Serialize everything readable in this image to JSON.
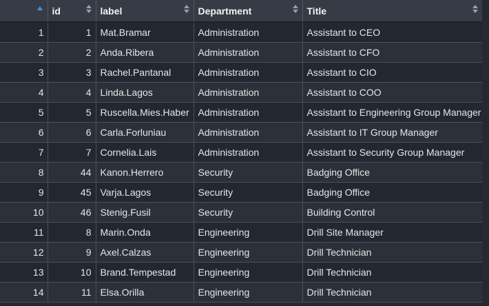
{
  "table": {
    "columns": [
      {
        "key": "rownum",
        "label": ""
      },
      {
        "key": "id",
        "label": "id"
      },
      {
        "key": "label",
        "label": "label"
      },
      {
        "key": "department",
        "label": "Department"
      },
      {
        "key": "title",
        "label": "Title"
      }
    ],
    "rows": [
      {
        "rownum": "1",
        "id": "1",
        "label": "Mat.Bramar",
        "department": "Administration",
        "title": "Assistant to CEO"
      },
      {
        "rownum": "2",
        "id": "2",
        "label": "Anda.Ribera",
        "department": "Administration",
        "title": "Assistant to CFO"
      },
      {
        "rownum": "3",
        "id": "3",
        "label": "Rachel.Pantanal",
        "department": "Administration",
        "title": "Assistant to CIO"
      },
      {
        "rownum": "4",
        "id": "4",
        "label": "Linda.Lagos",
        "department": "Administration",
        "title": "Assistant to COO"
      },
      {
        "rownum": "5",
        "id": "5",
        "label": "Ruscella.Mies.Haber",
        "department": "Administration",
        "title": "Assistant to Engineering Group Manager"
      },
      {
        "rownum": "6",
        "id": "6",
        "label": "Carla.Forluniau",
        "department": "Administration",
        "title": "Assistant to IT Group Manager"
      },
      {
        "rownum": "7",
        "id": "7",
        "label": "Cornelia.Lais",
        "department": "Administration",
        "title": "Assistant to Security Group Manager"
      },
      {
        "rownum": "8",
        "id": "44",
        "label": "Kanon.Herrero",
        "department": "Security",
        "title": "Badging Office"
      },
      {
        "rownum": "9",
        "id": "45",
        "label": "Varja.Lagos",
        "department": "Security",
        "title": "Badging Office"
      },
      {
        "rownum": "10",
        "id": "46",
        "label": "Stenig.Fusil",
        "department": "Security",
        "title": "Building Control"
      },
      {
        "rownum": "11",
        "id": "8",
        "label": "Marin.Onda",
        "department": "Engineering",
        "title": "Drill Site Manager"
      },
      {
        "rownum": "12",
        "id": "9",
        "label": "Axel.Calzas",
        "department": "Engineering",
        "title": "Drill Technician"
      },
      {
        "rownum": "13",
        "id": "10",
        "label": "Brand.Tempestad",
        "department": "Engineering",
        "title": "Drill Technician"
      },
      {
        "rownum": "14",
        "id": "11",
        "label": "Elsa.Orilla",
        "department": "Engineering",
        "title": "Drill Technician"
      }
    ]
  },
  "icons": {
    "sort_asc": "sort-ascending-icon",
    "sort": "sort-icon"
  },
  "colors": {
    "sort_active": "#4a90e2",
    "sort_inactive": "#9aa0a8"
  }
}
